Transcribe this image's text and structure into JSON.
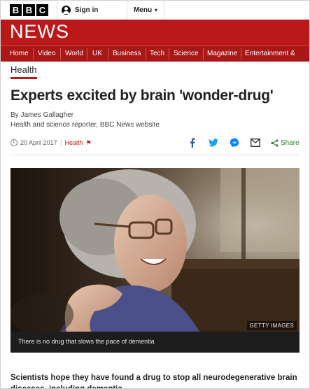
{
  "header": {
    "logo_letters": [
      "B",
      "B",
      "C"
    ],
    "signin_label": "Sign in",
    "menu_label": "Menu"
  },
  "brand": {
    "news_title": "NEWS",
    "accent": "#bb1919"
  },
  "nav": {
    "items": [
      "Home",
      "Video",
      "World",
      "UK",
      "Business",
      "Tech",
      "Science",
      "Magazine",
      "Entertainment & Arts"
    ]
  },
  "article": {
    "section": "Health",
    "headline": "Experts excited by brain 'wonder-drug'",
    "author": "By James Gallagher",
    "role": "Health and science reporter, BBC News website",
    "date": "20 April 2017",
    "tag": "Health",
    "share_label": "Share",
    "share_icons": [
      "facebook-icon",
      "twitter-icon",
      "messenger-icon",
      "email-icon",
      "share-icon"
    ],
    "image_credit": "GETTY IMAGES",
    "image_caption": "There is no drug that slows the pace of dementia",
    "intro": "Scientists hope they have found a drug to stop all neurodegenerative brain diseases, including dementia."
  }
}
